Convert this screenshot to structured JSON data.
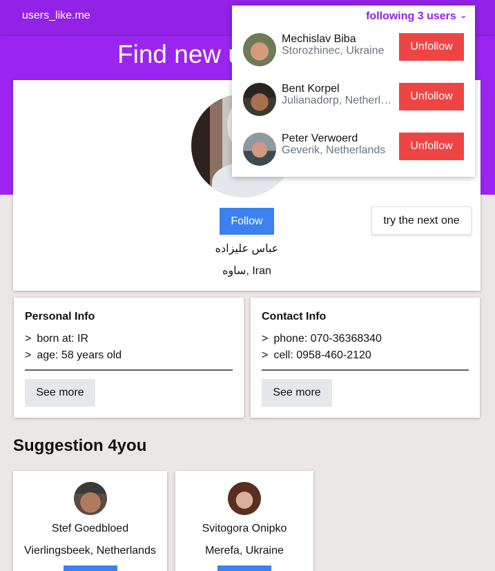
{
  "nav": {
    "brand": "users_like.me"
  },
  "hero": {
    "title": "Find new u"
  },
  "profile": {
    "follow_label": "Follow",
    "next_label": "try the next one",
    "name": "عباس علیزاده",
    "location": "ساوه, Iran"
  },
  "personal_info": {
    "title": "Personal Info",
    "lines": [
      "born at: IR",
      "age: 58 years old"
    ],
    "see_more": "See more"
  },
  "contact_info": {
    "title": "Contact Info",
    "lines": [
      "phone: 070-36368340",
      "cell: 0958-460-2120"
    ],
    "see_more": "See more"
  },
  "suggestions": {
    "title": "Suggestion 4you",
    "items": [
      {
        "name": "Stef Goedbloed",
        "location": "Vierlingsbeek, Netherlands"
      },
      {
        "name": "Svitogora Onipko",
        "location": "Merefa, Ukraine"
      }
    ]
  },
  "following": {
    "toggle_label": "following 3 users",
    "unfollow_label": "Unfollow",
    "users": [
      {
        "name": "Mechislav Biba",
        "location": "Storozhinec, Ukraine"
      },
      {
        "name": "Bent Korpel",
        "location": "Julianadorp, Netherlands"
      },
      {
        "name": "Peter Verwoerd",
        "location": "Geverik, Netherlands"
      }
    ]
  },
  "icons": {
    "chevron": "chevron-down-icon"
  },
  "colors": {
    "accent": "#9222e6",
    "primary": "#3b82f0",
    "danger": "#ef4444"
  }
}
